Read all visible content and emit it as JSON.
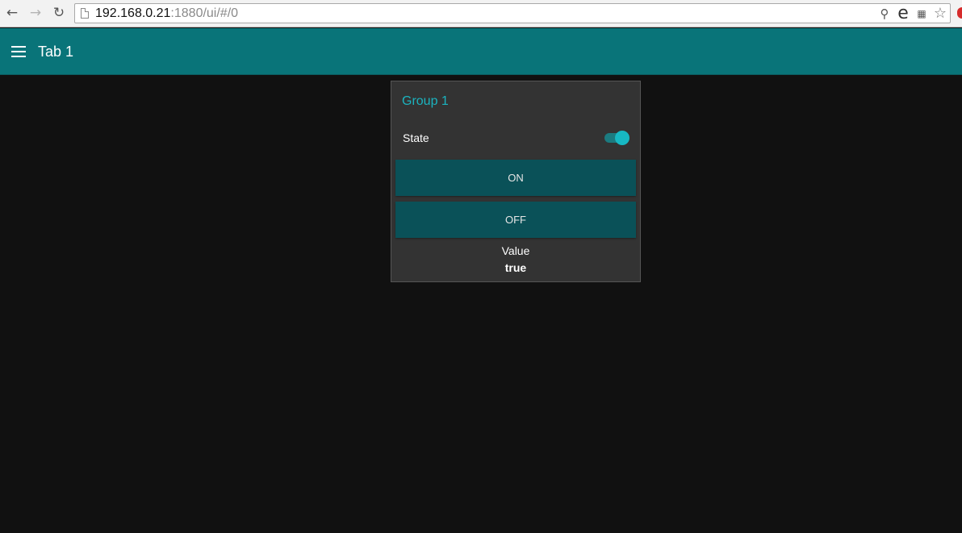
{
  "browser": {
    "url_host": "192.168.0.21",
    "url_rest": ":1880/ui/#/0",
    "icons": [
      "back-arrow-icon",
      "forward-arrow-icon",
      "reload-icon",
      "page-icon",
      "zoom-icon",
      "ie-icon",
      "translate-icon",
      "star-icon"
    ]
  },
  "toolbar": {
    "title": "Tab 1",
    "color": "#097479"
  },
  "group": {
    "title": "Group 1",
    "switch": {
      "label": "State",
      "on": true
    },
    "buttons": [
      {
        "label": "ON"
      },
      {
        "label": "OFF"
      }
    ],
    "text": {
      "label": "Value",
      "value": "true"
    }
  },
  "colors": {
    "background": "#111111",
    "card": "#333333",
    "accent": "#1bb3bf",
    "button": "#0a5158"
  }
}
